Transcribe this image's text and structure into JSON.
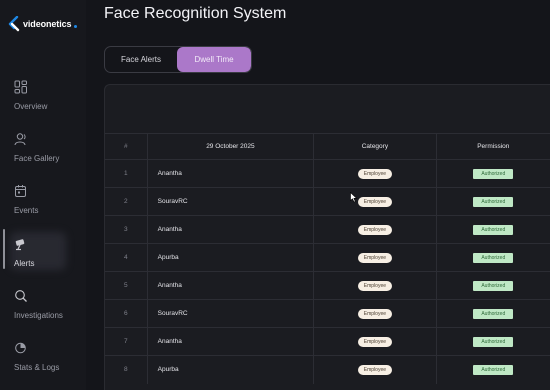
{
  "brand": {
    "name": "videonetics"
  },
  "sidebar": {
    "items": [
      {
        "label": "Overview",
        "icon": "overview-grid-icon"
      },
      {
        "label": "Face Gallery",
        "icon": "face-gallery-icon"
      },
      {
        "label": "Events",
        "icon": "calendar-icon"
      },
      {
        "label": "Alerts",
        "icon": "alert-camera-icon"
      },
      {
        "label": "Investigations",
        "icon": "investigation-search-icon"
      },
      {
        "label": "Stats & Logs",
        "icon": "stats-logs-icon"
      }
    ],
    "active_index": 3
  },
  "header": {
    "title": "Face Recognition System"
  },
  "tabs": [
    {
      "label": "Face Alerts",
      "active": false
    },
    {
      "label": "Dwell Time",
      "active": true
    }
  ],
  "table": {
    "columns": [
      "#",
      "29 October 2025",
      "Category",
      "Permission"
    ],
    "rows": [
      {
        "index": "1",
        "name": "Anantha",
        "category": "Employee",
        "permission": "Authorized"
      },
      {
        "index": "2",
        "name": "SouravRC",
        "category": "Employee",
        "permission": "Authorized"
      },
      {
        "index": "3",
        "name": "Anantha",
        "category": "Employee",
        "permission": "Authorized"
      },
      {
        "index": "4",
        "name": "Apurba",
        "category": "Employee",
        "permission": "Authorized"
      },
      {
        "index": "5",
        "name": "Anantha",
        "category": "Employee",
        "permission": "Authorized"
      },
      {
        "index": "6",
        "name": "SouravRC",
        "category": "Employee",
        "permission": "Authorized"
      },
      {
        "index": "7",
        "name": "Anantha",
        "category": "Employee",
        "permission": "Authorized"
      },
      {
        "index": "8",
        "name": "Apurba",
        "category": "Employee",
        "permission": "Authorized"
      }
    ]
  },
  "colors": {
    "accent_tab": "#ab78c9",
    "employee_pill": "#f7efe4",
    "authorized_badge": "#bfe8c5",
    "brand_blue": "#1e88e5"
  }
}
